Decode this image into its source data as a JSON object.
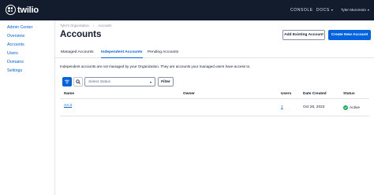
{
  "topbar": {
    "logo_text": "twilio",
    "console": "CONSOLE",
    "docs": "DOCS",
    "user": "Tyler Muromoto",
    "chevron": "▾"
  },
  "sidebar": {
    "items": [
      {
        "label": "Admin Center"
      },
      {
        "label": "Overview"
      },
      {
        "label": "Accounts"
      },
      {
        "label": "Users"
      },
      {
        "label": "Domains"
      },
      {
        "label": "Settings"
      }
    ]
  },
  "breadcrumb": {
    "items": [
      "Tyler's Organization",
      "Accounts"
    ],
    "separator": "›"
  },
  "page": {
    "title": "Accounts",
    "add_existing_label": "Add Existing Account",
    "create_new_label": "Create New Account"
  },
  "tabs": [
    {
      "label": "Managed Accounts",
      "active": false
    },
    {
      "label": "Independent Accounts",
      "active": true
    },
    {
      "label": "Pending Accounts",
      "active": false
    }
  ],
  "info_text": "Independent accounts are not managed by your Organization. They are accounts your managed users have access to.",
  "filters": {
    "status_placeholder": "Select Status",
    "filter_label": "Filter"
  },
  "table": {
    "headers": {
      "name": "Name",
      "owner": "Owner",
      "users": "Users",
      "date": "Date Created",
      "status": "Status"
    },
    "rows": [
      {
        "name": "AA 2",
        "owner": "",
        "users": "1",
        "date": "Oct 25, 2023",
        "status": "Active"
      }
    ]
  },
  "colors": {
    "topbar": "#121c2d",
    "accent": "#0263e0",
    "success": "#14b053"
  }
}
